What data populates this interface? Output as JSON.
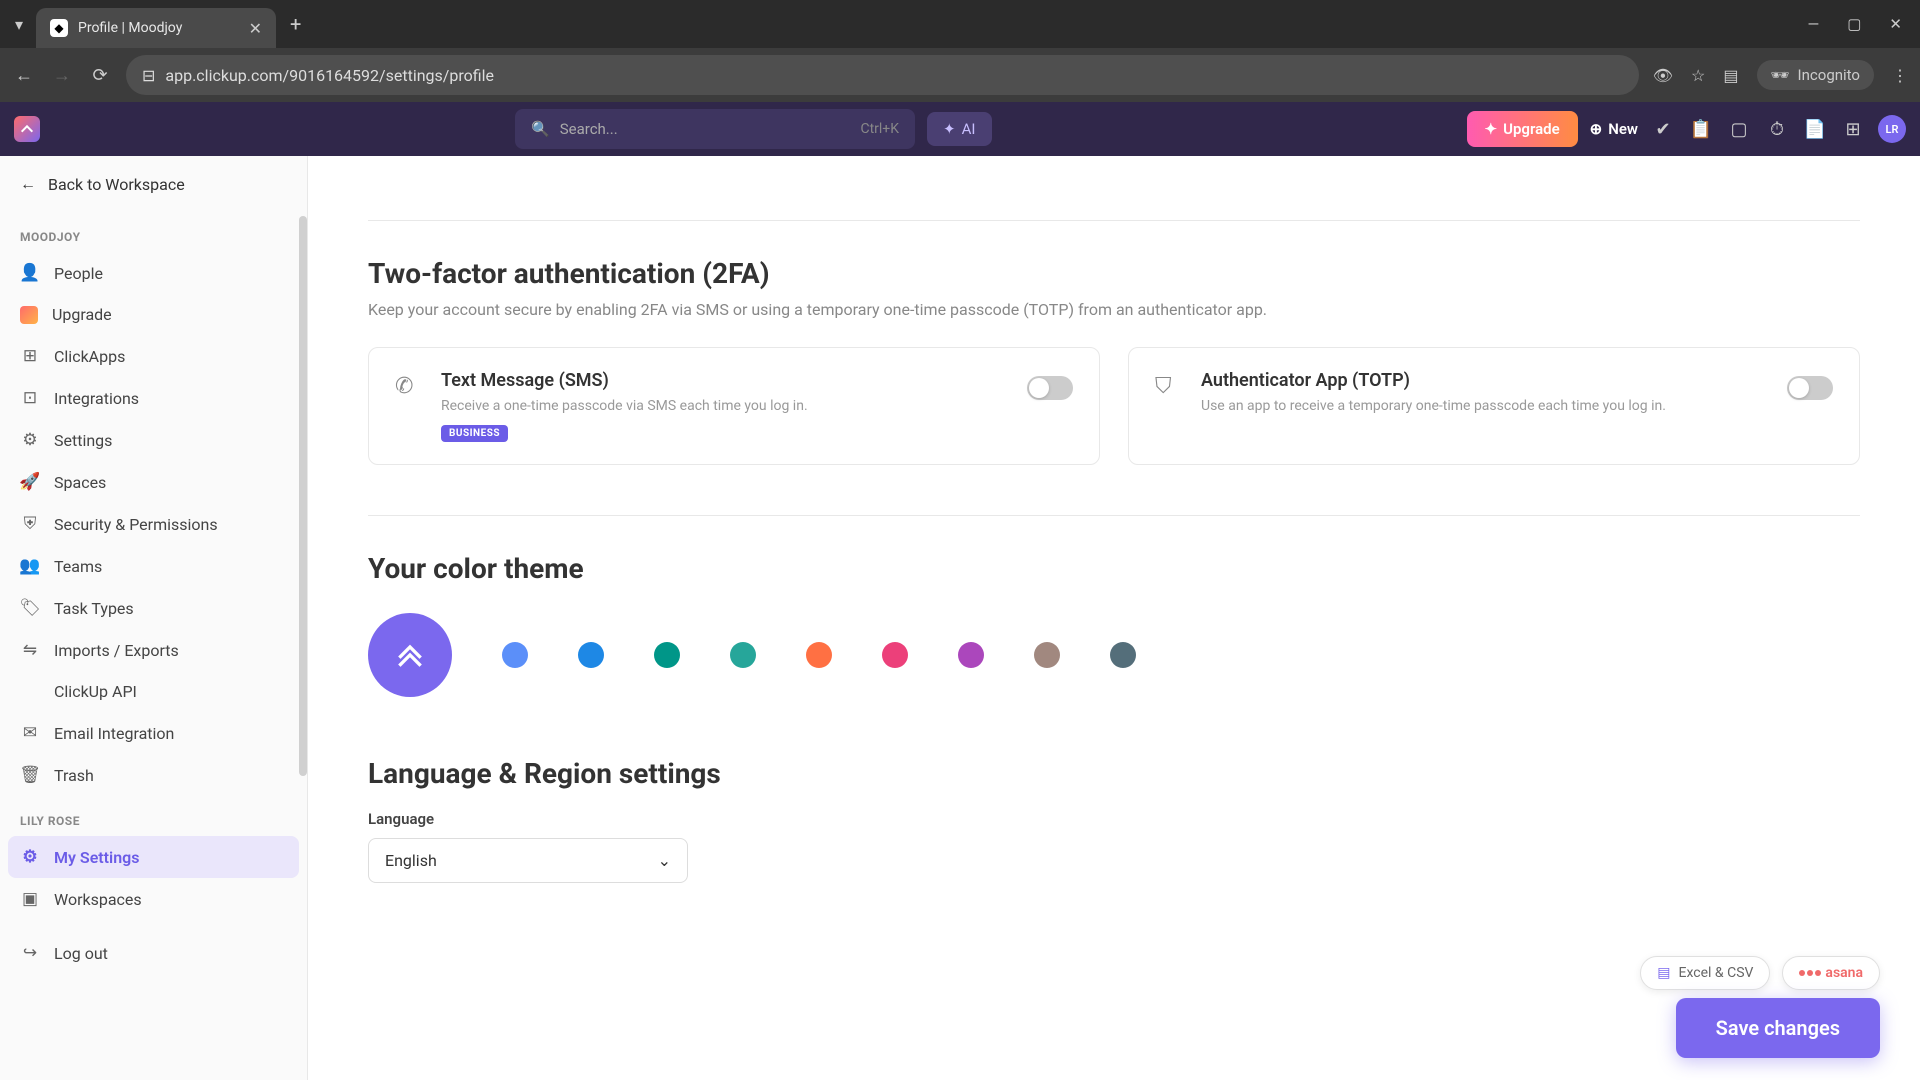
{
  "browser": {
    "tab_title": "Profile | Moodjoy",
    "url": "app.clickup.com/9016164592/settings/profile",
    "incognito_label": "Incognito"
  },
  "header": {
    "search_placeholder": "Search...",
    "search_shortcut": "Ctrl+K",
    "ai_label": "AI",
    "upgrade_label": "Upgrade",
    "new_label": "New",
    "avatar_initials": "LR"
  },
  "sidebar": {
    "back_label": "Back to Workspace",
    "workspace_label": "MOODJOY",
    "workspace_items": [
      {
        "label": "People",
        "icon": "person"
      },
      {
        "label": "Upgrade",
        "icon": "upgrade"
      },
      {
        "label": "ClickApps",
        "icon": "apps"
      },
      {
        "label": "Integrations",
        "icon": "puzzle"
      },
      {
        "label": "Settings",
        "icon": "gear"
      },
      {
        "label": "Spaces",
        "icon": "rocket"
      },
      {
        "label": "Security & Permissions",
        "icon": "shield"
      },
      {
        "label": "Teams",
        "icon": "people"
      },
      {
        "label": "Task Types",
        "icon": "tag"
      },
      {
        "label": "Imports / Exports",
        "icon": "import"
      },
      {
        "label": "ClickUp API",
        "icon": "code"
      },
      {
        "label": "Email Integration",
        "icon": "mail"
      },
      {
        "label": "Trash",
        "icon": "trash"
      }
    ],
    "user_label": "LILY ROSE",
    "user_items": [
      {
        "label": "My Settings",
        "icon": "gear",
        "active": true
      },
      {
        "label": "Workspaces",
        "icon": "workspace"
      }
    ],
    "logout_label": "Log out"
  },
  "content": {
    "twofa": {
      "title": "Two-factor authentication (2FA)",
      "desc": "Keep your account secure by enabling 2FA via SMS or using a temporary one-time passcode (TOTP) from an authenticator app.",
      "sms": {
        "title": "Text Message (SMS)",
        "desc": "Receive a one-time passcode via SMS each time you log in.",
        "badge": "BUSINESS"
      },
      "totp": {
        "title": "Authenticator App (TOTP)",
        "desc": "Use an app to receive a temporary one-time passcode each time you log in."
      }
    },
    "theme": {
      "title": "Your color theme",
      "colors": [
        "#7b68ee",
        "#5b8ff9",
        "#1e88e5",
        "#009688",
        "#26a69a",
        "#ff7043",
        "#ec407a",
        "#ab47bc",
        "#a1887f",
        "#546e7a"
      ]
    },
    "language": {
      "title": "Language & Region settings",
      "field_label": "Language",
      "selected": "English"
    },
    "save_label": "Save changes",
    "float": {
      "excel_label": "Excel & CSV",
      "asana_label": "asana"
    }
  }
}
